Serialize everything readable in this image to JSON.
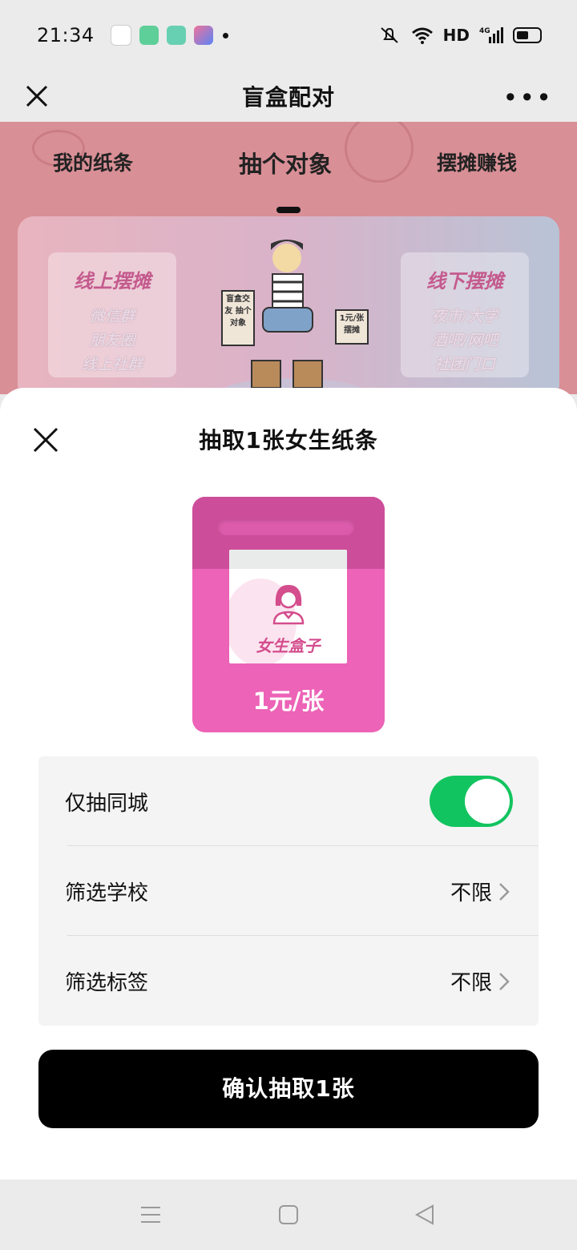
{
  "status_bar": {
    "time": "21:34",
    "network_label": "HD",
    "signal_label": "4G",
    "icons": [
      "news-app-icon",
      "phone-app-icon",
      "message-app-icon",
      "pen-app-icon",
      "mute-icon",
      "wifi-icon",
      "signal-icon",
      "battery-icon"
    ]
  },
  "nav_bar": {
    "title": "盲盒配对",
    "more": "•••"
  },
  "background_page": {
    "tabs": [
      "我的纸条",
      "抽个对象",
      "摆摊赚钱"
    ],
    "active_tab": "抽个对象",
    "banner": {
      "left_card": {
        "title": "线上摆摊",
        "lines": [
          "微信群",
          "朋友圈",
          "线上社群"
        ]
      },
      "right_card": {
        "title": "线下摆摊",
        "lines": [
          "夜市/大学",
          "酒吧/网吧",
          "社团门口"
        ]
      },
      "sign_left": "盲盒交友 抽个对象",
      "sign_right": "1元/张 摆摊"
    }
  },
  "sheet": {
    "title": "抽取1张女生纸条",
    "box": {
      "label": "女生盒子",
      "price": "1元/张",
      "color": "#ec63b7"
    },
    "filters": [
      {
        "label": "仅抽同城",
        "type": "toggle",
        "on": true
      },
      {
        "label": "筛选学校",
        "type": "select",
        "value": "不限"
      },
      {
        "label": "筛选标签",
        "type": "select",
        "value": "不限"
      }
    ],
    "confirm_label": "确认抽取1张"
  },
  "colors": {
    "toggle_on": "#12c45f",
    "confirm_bg": "#000000"
  }
}
